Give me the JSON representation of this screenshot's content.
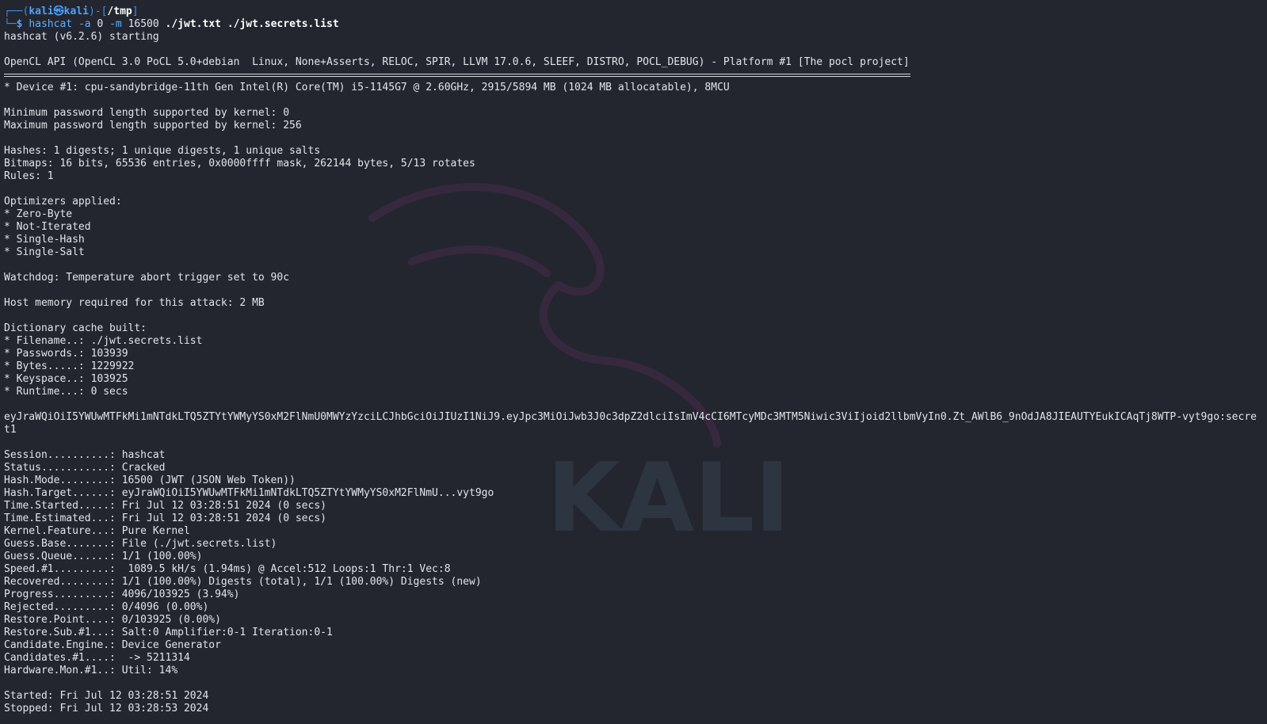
{
  "prompt": {
    "frame_top": "┌──(",
    "user": "kali㉿kali",
    "mid": ")-[",
    "path": "/tmp",
    "end": "]",
    "frame_bottom": "└─",
    "dollar": "$ "
  },
  "command": {
    "program": "hashcat",
    "flag_a": "-a",
    "val_a": "0",
    "flag_m": "-m",
    "val_m": "16500",
    "file1": "./jwt.txt",
    "file2": "./jwt.secrets.list"
  },
  "output_head": [
    "hashcat (v6.2.6) starting",
    "",
    "OpenCL API (OpenCL 3.0 PoCL 5.0+debian  Linux, None+Asserts, RELOC, SPIR, LLVM 17.0.6, SLEEF, DISTRO, POCL_DEBUG) - Platform #1 [The pocl project]"
  ],
  "output_body": [
    "* Device #1: cpu-sandybridge-11th Gen Intel(R) Core(TM) i5-1145G7 @ 2.60GHz, 2915/5894 MB (1024 MB allocatable), 8MCU",
    "",
    "Minimum password length supported by kernel: 0",
    "Maximum password length supported by kernel: 256",
    "",
    "Hashes: 1 digests; 1 unique digests, 1 unique salts",
    "Bitmaps: 16 bits, 65536 entries, 0x0000ffff mask, 262144 bytes, 5/13 rotates",
    "Rules: 1",
    "",
    "Optimizers applied:",
    "* Zero-Byte",
    "* Not-Iterated",
    "* Single-Hash",
    "* Single-Salt",
    "",
    "Watchdog: Temperature abort trigger set to 90c",
    "",
    "Host memory required for this attack: 2 MB",
    "",
    "Dictionary cache built:",
    "* Filename..: ./jwt.secrets.list",
    "* Passwords.: 103939",
    "* Bytes.....: 1229922",
    "* Keyspace..: 103925",
    "* Runtime...: 0 secs",
    ""
  ],
  "cracked_line": "eyJraWQiOiI5YWUwMTFkMi1mNTdkLTQ5ZTYtYWMyYS0xM2FlNmU0MWYzYzciLCJhbGciOiJIUzI1NiJ9.eyJpc3MiOiJwb3J0c3dpZ2dlciIsImV4cCI6MTcyMDc3MTM5Niwic3ViIjoid2llbmVyIn0.Zt_AWlB6_9nOdJA8JIEAUTYEukICAqTj8WTP-vyt9go:secret1",
  "status": [
    "",
    "Session..........: hashcat",
    "Status...........: Cracked",
    "Hash.Mode........: 16500 (JWT (JSON Web Token))",
    "Hash.Target......: eyJraWQiOiI5YWUwMTFkMi1mNTdkLTQ5ZTYtYWMyYS0xM2FlNmU...vyt9go",
    "Time.Started.....: Fri Jul 12 03:28:51 2024 (0 secs)",
    "Time.Estimated...: Fri Jul 12 03:28:51 2024 (0 secs)",
    "Kernel.Feature...: Pure Kernel",
    "Guess.Base.......: File (./jwt.secrets.list)",
    "Guess.Queue......: 1/1 (100.00%)",
    "Speed.#1.........:  1089.5 kH/s (1.94ms) @ Accel:512 Loops:1 Thr:1 Vec:8",
    "Recovered........: 1/1 (100.00%) Digests (total), 1/1 (100.00%) Digests (new)",
    "Progress.........: 4096/103925 (3.94%)",
    "Rejected.........: 0/4096 (0.00%)",
    "Restore.Point....: 0/103925 (0.00%)",
    "Restore.Sub.#1...: Salt:0 Amplifier:0-1 Iteration:0-1",
    "Candidate.Engine.: Device Generator",
    "Candidates.#1....:  -> 5211314",
    "Hardware.Mon.#1..: Util: 14%",
    "",
    "Started: Fri Jul 12 03:28:51 2024",
    "Stopped: Fri Jul 12 03:28:53 2024"
  ],
  "watermark_text": "KALI",
  "colors": {
    "background": "#23262f",
    "text": "#e2e4e9",
    "prompt_blue": "#4ca3ff",
    "dragon": "#3a2a40",
    "watermark": "#2d3640"
  }
}
